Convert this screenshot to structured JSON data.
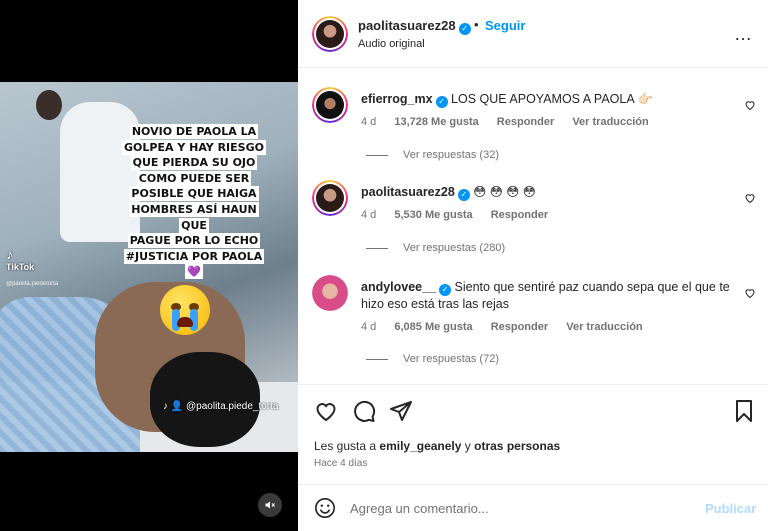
{
  "post": {
    "overlay_lines": [
      "NOVIO DE PAOLA LA",
      "GOLPEA Y HAY RIESGO",
      "QUE PIERDA SU OJO",
      "COMO PUEDE SER",
      "POSIBLE QUE HAIGA",
      "HOMBRES ASÍ HAUN QUE",
      "PAGUE POR LO ECHO",
      "#JUSTICIA POR PAOLA💜"
    ],
    "tiktok_label": "TikTok",
    "tiktok_user": "@paolita.piedetorta",
    "handle": "@paolita.piede_torta"
  },
  "header": {
    "username": "paolitasuarez28",
    "dot": "•",
    "follow_label": "Seguir",
    "audio": "Audio original",
    "more_icon": "…"
  },
  "comments": [
    {
      "username": "efierrog_mx",
      "text": "LOS QUE APOYAMOS A PAOLA 👉🏻",
      "time": "4 d",
      "likes": "13,728 Me gusta",
      "reply": "Responder",
      "translate": "Ver traducción",
      "replies": "Ver respuestas (32)"
    },
    {
      "username": "paolitasuarez28",
      "text": "😳 😳 😳 😳",
      "time": "4 d",
      "likes": "5,530 Me gusta",
      "reply": "Responder",
      "translate": "",
      "replies": "Ver respuestas (280)"
    },
    {
      "username": "andylovee__",
      "text": "Siento que sentiré paz cuando sepa que el que te hizo eso está tras las rejas",
      "time": "4 d",
      "likes": "6,085 Me gusta",
      "reply": "Responder",
      "translate": "Ver traducción",
      "replies": "Ver respuestas (72)"
    }
  ],
  "actions": {
    "likes_prefix": "Les gusta a",
    "likes_user": "emily_geanely",
    "likes_and": "y",
    "likes_others": "otras personas",
    "ago": "Hace 4 días"
  },
  "add_comment": {
    "placeholder": "Agrega un comentario...",
    "publish_label": "Publicar"
  },
  "colors": {
    "accent": "#0095f6",
    "publish_disabled": "#b3dbff",
    "meta": "#737373"
  }
}
